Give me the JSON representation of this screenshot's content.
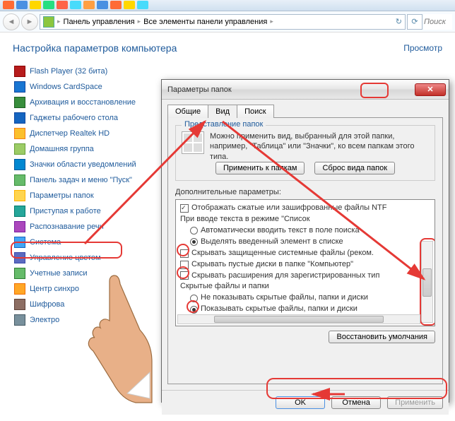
{
  "taskbar_colors": [
    "#ff6b35",
    "#4a90e2",
    "#ffd700",
    "#26de81",
    "#ff6348",
    "#48dbfb",
    "#ff9f43"
  ],
  "nav": {
    "crumb1": "Панель управления",
    "crumb2": "Все элементы панели управления",
    "search_placeholder": "Поиск"
  },
  "main": {
    "title": "Настройка параметров компьютера",
    "view_link": "Просмотр"
  },
  "items": [
    {
      "label": "Flash Player (32 бита)",
      "ico": "i-fl"
    },
    {
      "label": "Windows CardSpace",
      "ico": "i-wc"
    },
    {
      "label": "Архивация и восстановление",
      "ico": "i-ar"
    },
    {
      "label": "Гаджеты рабочего стола",
      "ico": "i-gd"
    },
    {
      "label": "Диспетчер Realtek HD",
      "ico": "i-rt"
    },
    {
      "label": "Домашняя группа",
      "ico": "i-hg"
    },
    {
      "label": "Значки области уведомлений",
      "ico": "i-zn"
    },
    {
      "label": "Панель задач и меню \"Пуск\"",
      "ico": "i-tb"
    },
    {
      "label": "Параметры папок",
      "ico": "i-fo"
    },
    {
      "label": "Приступая к работе",
      "ico": "i-pr"
    },
    {
      "label": "Распознавание речи",
      "ico": "i-sp"
    },
    {
      "label": "Система",
      "ico": "i-sy"
    },
    {
      "label": "Управление цветом",
      "ico": "i-cl"
    },
    {
      "label": "Учетные записи",
      "ico": "i-ua"
    },
    {
      "label": "Центр синхро",
      "ico": "i-cs"
    },
    {
      "label": "Шифрова",
      "ico": "i-sh"
    },
    {
      "label": "Электро",
      "ico": "i-el"
    }
  ],
  "dialog": {
    "title": "Параметры папок",
    "tabs": {
      "general": "Общие",
      "view": "Вид",
      "search": "Поиск"
    },
    "group_title": "Представление папок",
    "group_text": "Можно применить вид, выбранный для этой папки, например, \"Таблица\" или \"Значки\", ко всем папкам этого типа.",
    "apply_to_folders": "Применить к папкам",
    "reset_folders": "Сброс вида папок",
    "advanced_label": "Дополнительные параметры:",
    "tree": {
      "r0": "Отображать сжатые или зашифрованные файлы NTF",
      "r1": "При вводе текста в режиме \"Список",
      "r1a": "Автоматически вводить текст в поле поиска",
      "r1b": "Выделять введенный элемент в списке",
      "r2": "Скрывать защищенные системные файлы (реком.",
      "r3": "Скрывать пустые диски в папке \"Компьютер\"",
      "r4": "Скрывать расширения для зарегистрированных тип",
      "r5": "Скрытые файлы и папки",
      "r5a": "Не показывать скрытые файлы, папки и диски",
      "r5b": "Показывать скрытые файлы, папки и диски"
    },
    "restore_defaults": "Восстановить умолчания",
    "ok": "OK",
    "cancel": "Отмена",
    "apply": "Применить"
  }
}
